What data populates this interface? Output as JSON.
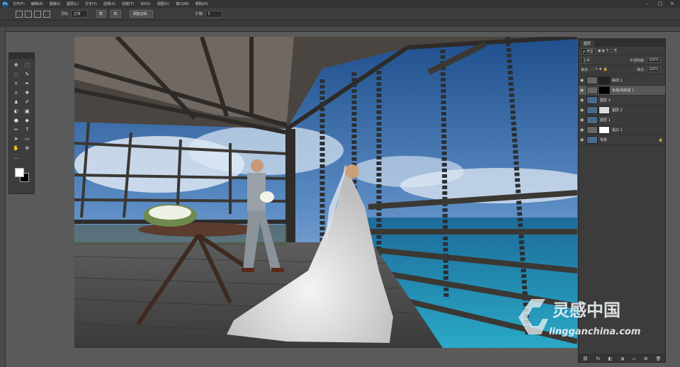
{
  "menubar": {
    "logo": "Ps",
    "items": [
      "文件(F)",
      "编辑(E)",
      "图像(I)",
      "图层(L)",
      "文字(Y)",
      "选择(S)",
      "滤镜(T)",
      "3D(D)",
      "视图(V)",
      "窗口(W)",
      "帮助(H)"
    ],
    "minimize": "–",
    "maximize": "□",
    "close": "×"
  },
  "options": {
    "feather_label": "羽化:",
    "feather_value": "0 像素",
    "mode_value": "正常",
    "btn_1": "宽:",
    "btn_2": "高:",
    "adjust_label": "调整边缘...",
    "expand_label": "扩散:",
    "expand_value": "5"
  },
  "toolbox": {
    "tools": [
      "✥",
      "⬚",
      "◌",
      "✎",
      "⌗",
      "✒",
      "⟡",
      "✚",
      "♟",
      "✐",
      "◐",
      "▣",
      "●",
      "◆",
      "✏",
      "T",
      "➤",
      "▭",
      "✋",
      "⊕",
      "…",
      ""
    ]
  },
  "layers_panel": {
    "tab_label": "图层",
    "kind_filter": "ρ 类型",
    "blend_mode": "正常",
    "opacity_label": "不透明度:",
    "opacity_value": "100%",
    "lock_label": "锁定:",
    "fill_label": "填充:",
    "fill_value": "100%",
    "layers": [
      {
        "name": "曲线 1",
        "selected": false
      },
      {
        "name": "色相/饱和度 1",
        "selected": true
      },
      {
        "name": "图层 3",
        "selected": false
      },
      {
        "name": "图层 2",
        "selected": false
      },
      {
        "name": "图层 1",
        "selected": false
      },
      {
        "name": "黑白 1",
        "selected": false
      },
      {
        "name": "背景",
        "selected": false
      }
    ],
    "footer_icons": [
      "⛓",
      "fx",
      "◧",
      "◑",
      "▭",
      "⊞",
      "🗑"
    ]
  },
  "watermark": {
    "brand_cn": "灵感中国",
    "domain": "lingganchina.com"
  },
  "colors": {
    "panel_bg": "#3c3c3c",
    "canvas_bg": "#5a5a5a",
    "menubar_bg": "#333333",
    "selected_layer": "#585858"
  }
}
